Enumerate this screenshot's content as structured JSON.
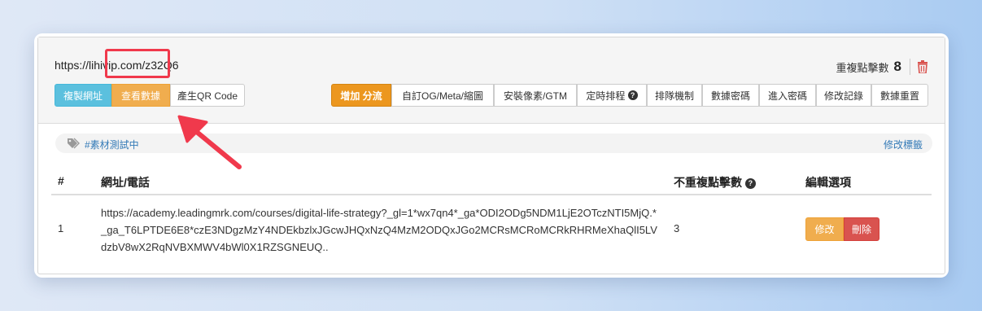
{
  "link": {
    "short_url": "https://lihivip.com/z32Q6",
    "clicks_label": "重複點擊數",
    "clicks_value": "8"
  },
  "toolbar_left": [
    "複製網址",
    "查看數據",
    "產生QR Code"
  ],
  "toolbar_right": [
    "增加 分流",
    "自訂OG/Meta/縮圖",
    "安裝像素/GTM",
    "定時排程",
    "排隊機制",
    "數據密碼",
    "進入密碼",
    "修改記錄",
    "數據重置"
  ],
  "tag": {
    "label": "#素材測試中",
    "edit": "修改標籤"
  },
  "table": {
    "headers": [
      "#",
      "網址/電話",
      "不重複點擊數",
      "編輯選項"
    ],
    "rows": [
      {
        "index": "1",
        "url": "https://academy.leadingmrk.com/courses/digital-life-strategy?_gl=1*wx7qn4*_ga*ODI2ODg5NDM1LjE2OTczNTI5MjQ.*_ga_T6LPTDE6E8*czE3NDgzMzY4NDEkbzlxJGcwJHQxNzQ4MzM2ODQxJGo2MCRsMCRoMCRkRHRMeXhaQlI5LVdzbV8wX2RqNVBXMWV4bWl0X1RZSGNEUQ..",
        "unique_clicks": "3",
        "edit": "修改",
        "delete": "刪除"
      }
    ]
  },
  "colors": {
    "info": "#5bc0de",
    "warning": "#f0ad4e",
    "danger": "#d9534f",
    "highlight": "#f0394c"
  }
}
